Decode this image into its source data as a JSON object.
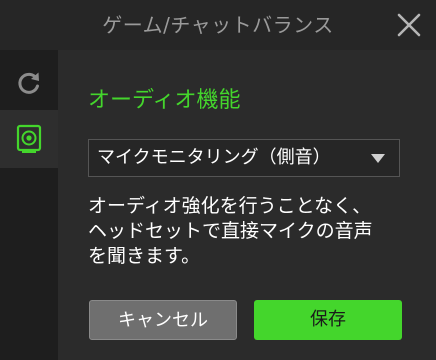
{
  "window": {
    "title": "ゲーム/チャットバランス"
  },
  "sidebar": {
    "items": [
      {
        "icon": "refresh-icon",
        "active": false
      },
      {
        "icon": "speaker-icon",
        "active": true
      }
    ]
  },
  "main": {
    "section_title": "オーディオ機能",
    "dropdown": {
      "selected": "マイクモニタリング（側音）"
    },
    "description_lines": [
      "オーディオ強化を行うことなく、",
      "ヘッドセットで直接マイクの音声",
      "を聞きます。"
    ],
    "buttons": {
      "cancel_label": "キャンセル",
      "save_label": "保存"
    }
  },
  "colors": {
    "accent": "#44d62c",
    "background": "#2b2b2b",
    "sidebar": "#1e1e1e"
  }
}
